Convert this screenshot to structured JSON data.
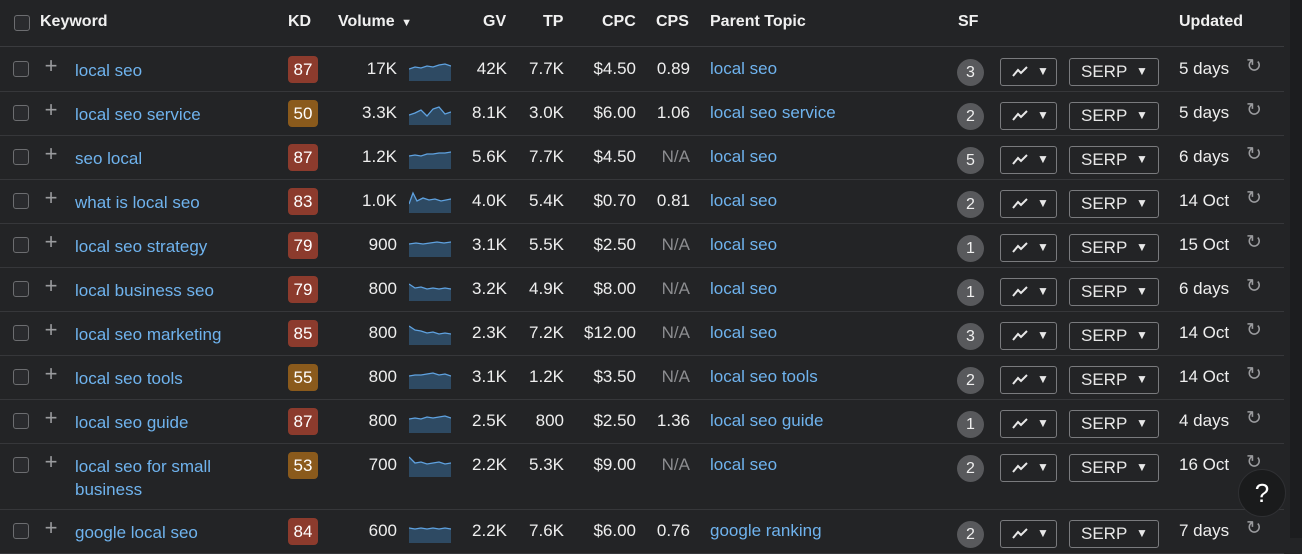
{
  "header": {
    "keyword": "Keyword",
    "kd": "KD",
    "volume": "Volume",
    "gv": "GV",
    "tp": "TP",
    "cpc": "CPC",
    "cps": "CPS",
    "parent_topic": "Parent Topic",
    "sf": "SF",
    "updated": "Updated"
  },
  "serp_label": "SERP",
  "help_label": "?",
  "colors": {
    "kd_red": "#8c3b2d",
    "kd_orange": "#8a5a1c",
    "link": "#6fb3ee",
    "background": "#232426"
  },
  "rows": [
    {
      "keyword": "local seo",
      "kd": "87",
      "kd_color": "#8c3b2d",
      "volume": "17K",
      "gv": "42K",
      "tp": "7.7K",
      "cpc": "$4.50",
      "cps": "0.89",
      "parent_topic": "local seo",
      "sf": "3",
      "updated": "5 days"
    },
    {
      "keyword": "local seo service",
      "kd": "50",
      "kd_color": "#8a5a1c",
      "volume": "3.3K",
      "gv": "8.1K",
      "tp": "3.0K",
      "cpc": "$6.00",
      "cps": "1.06",
      "parent_topic": "local seo service",
      "sf": "2",
      "updated": "5 days"
    },
    {
      "keyword": "seo local",
      "kd": "87",
      "kd_color": "#8c3b2d",
      "volume": "1.2K",
      "gv": "5.6K",
      "tp": "7.7K",
      "cpc": "$4.50",
      "cps": "N/A",
      "parent_topic": "local seo",
      "sf": "5",
      "updated": "6 days"
    },
    {
      "keyword": "what is local seo",
      "kd": "83",
      "kd_color": "#8c3b2d",
      "volume": "1.0K",
      "gv": "4.0K",
      "tp": "5.4K",
      "cpc": "$0.70",
      "cps": "0.81",
      "parent_topic": "local seo",
      "sf": "2",
      "updated": "14 Oct"
    },
    {
      "keyword": "local seo strategy",
      "kd": "79",
      "kd_color": "#8c3b2d",
      "volume": "900",
      "gv": "3.1K",
      "tp": "5.5K",
      "cpc": "$2.50",
      "cps": "N/A",
      "parent_topic": "local seo",
      "sf": "1",
      "updated": "15 Oct"
    },
    {
      "keyword": "local business seo",
      "kd": "79",
      "kd_color": "#8c3b2d",
      "volume": "800",
      "gv": "3.2K",
      "tp": "4.9K",
      "cpc": "$8.00",
      "cps": "N/A",
      "parent_topic": "local seo",
      "sf": "1",
      "updated": "6 days"
    },
    {
      "keyword": "local seo marketing",
      "kd": "85",
      "kd_color": "#8c3b2d",
      "volume": "800",
      "gv": "2.3K",
      "tp": "7.2K",
      "cpc": "$12.00",
      "cps": "N/A",
      "parent_topic": "local seo",
      "sf": "3",
      "updated": "14 Oct"
    },
    {
      "keyword": "local seo tools",
      "kd": "55",
      "kd_color": "#8a5a1c",
      "volume": "800",
      "gv": "3.1K",
      "tp": "1.2K",
      "cpc": "$3.50",
      "cps": "N/A",
      "parent_topic": "local seo tools",
      "sf": "2",
      "updated": "14 Oct"
    },
    {
      "keyword": "local seo guide",
      "kd": "87",
      "kd_color": "#8c3b2d",
      "volume": "800",
      "gv": "2.5K",
      "tp": "800",
      "cpc": "$2.50",
      "cps": "1.36",
      "parent_topic": "local seo guide",
      "sf": "1",
      "updated": "4 days"
    },
    {
      "keyword": "local seo for small business",
      "kd": "53",
      "kd_color": "#8a5a1c",
      "volume": "700",
      "gv": "2.2K",
      "tp": "5.3K",
      "cpc": "$9.00",
      "cps": "N/A",
      "parent_topic": "local seo",
      "sf": "2",
      "updated": "16 Oct"
    },
    {
      "keyword": "google local seo",
      "kd": "84",
      "kd_color": "#8c3b2d",
      "volume": "600",
      "gv": "2.2K",
      "tp": "7.6K",
      "cpc": "$6.00",
      "cps": "0.76",
      "parent_topic": "google ranking",
      "sf": "2",
      "updated": "7 days"
    }
  ]
}
